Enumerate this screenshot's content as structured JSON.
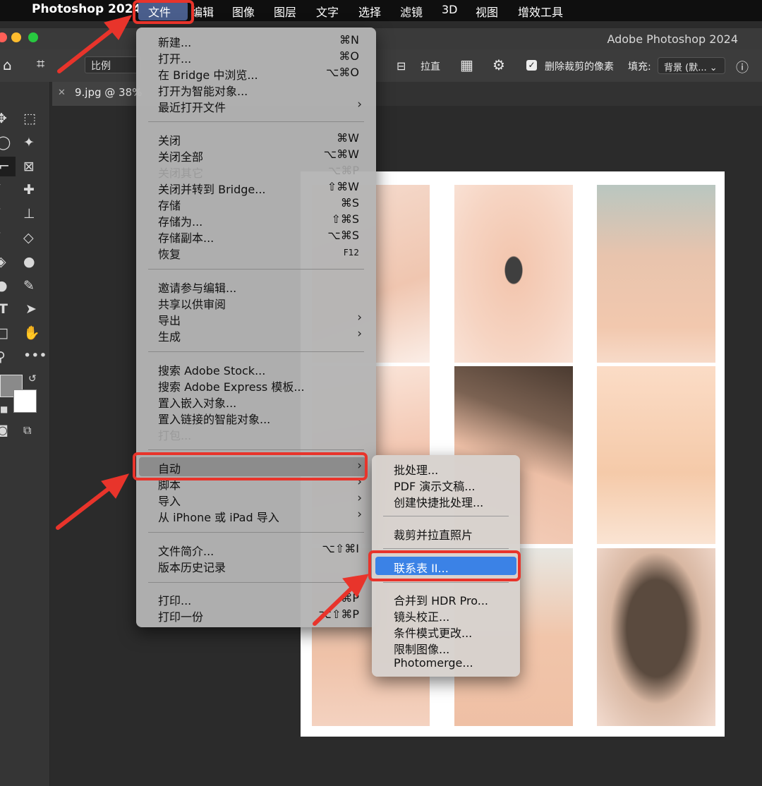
{
  "menubar": {
    "apple_icon": "apple-icon",
    "app_name": "Photoshop 2024",
    "items": [
      "文件",
      "编辑",
      "图像",
      "图层",
      "文字",
      "选择",
      "滤镜",
      "3D",
      "视图",
      "增效工具"
    ]
  },
  "window": {
    "title": "Adobe Photoshop 2024"
  },
  "options_bar": {
    "ratio": "比例",
    "straighten": "拉直",
    "delete_cropped": "删除裁剪的像素",
    "delete_cropped_checked": true,
    "fill_label": "填充:",
    "fill_value": "背景 (默...",
    "icons": [
      "home-icon",
      "crop-icon",
      "straighten-icon",
      "grid-overlay-icon",
      "gear-icon",
      "info-icon"
    ]
  },
  "tab": {
    "name": "9.jpg @ 38%"
  },
  "file_menu": {
    "items": [
      {
        "label": "新建...",
        "shortcut": "⌘N"
      },
      {
        "label": "打开...",
        "shortcut": "⌘O"
      },
      {
        "label": "在 Bridge 中浏览...",
        "shortcut": "⌥⌘O"
      },
      {
        "label": "打开为智能对象..."
      },
      {
        "label": "最近打开文件",
        "submenu": true
      },
      {
        "label": "关闭",
        "shortcut": "⌘W"
      },
      {
        "label": "关闭全部",
        "shortcut": "⌥⌘W"
      },
      {
        "label": "关闭其它",
        "shortcut": "⌥⌘P",
        "disabled": true
      },
      {
        "label": "关闭并转到 Bridge...",
        "shortcut": "⇧⌘W"
      },
      {
        "label": "存储",
        "shortcut": "⌘S"
      },
      {
        "label": "存储为...",
        "shortcut": "⇧⌘S"
      },
      {
        "label": "存储副本...",
        "shortcut": "⌥⌘S"
      },
      {
        "label": "恢复",
        "shortcut": "F12"
      },
      {
        "label": "邀请参与编辑..."
      },
      {
        "label": "共享以供审阅"
      },
      {
        "label": "导出",
        "submenu": true
      },
      {
        "label": "生成",
        "submenu": true
      },
      {
        "label": "搜索 Adobe Stock..."
      },
      {
        "label": "搜索 Adobe Express 模板..."
      },
      {
        "label": "置入嵌入对象..."
      },
      {
        "label": "置入链接的智能对象..."
      },
      {
        "label": "打包...",
        "disabled": true
      },
      {
        "label": "自动",
        "submenu": true,
        "highlighted": true
      },
      {
        "label": "脚本",
        "submenu": true
      },
      {
        "label": "导入",
        "submenu": true
      },
      {
        "label": "从 iPhone 或 iPad 导入",
        "submenu": true
      },
      {
        "label": "文件简介...",
        "shortcut": "⌥⇧⌘I"
      },
      {
        "label": "版本历史记录"
      },
      {
        "label": "打印...",
        "shortcut": "⌘P"
      },
      {
        "label": "打印一份",
        "shortcut": "⌥⇧⌘P"
      }
    ]
  },
  "automate_submenu": {
    "items": [
      {
        "label": "批处理..."
      },
      {
        "label": "PDF 演示文稿..."
      },
      {
        "label": "创建快捷批处理..."
      },
      {
        "label": "裁剪并拉直照片"
      },
      {
        "label": "联系表 II...",
        "highlighted": true
      },
      {
        "label": "合并到 HDR Pro..."
      },
      {
        "label": "镜头校正..."
      },
      {
        "label": "条件模式更改..."
      },
      {
        "label": "限制图像..."
      },
      {
        "label": "Photomerge..."
      }
    ]
  },
  "toolbar": {
    "tools": [
      "move-icon",
      "marquee-icon",
      "lasso-icon",
      "magic-wand-icon",
      "crop-icon",
      "frame-icon",
      "eyedropper-icon",
      "healing-brush-icon",
      "brush-icon",
      "clone-stamp-icon",
      "history-brush-icon",
      "eraser-icon",
      "paint-bucket-icon",
      "blur-icon",
      "dodge-icon",
      "pen-icon",
      "type-icon",
      "path-selection-icon",
      "rectangle-icon",
      "hand-icon",
      "zoom-icon",
      "more-tools-icon",
      "swap-colors-icon",
      "default-colors-icon",
      "quick-mask-icon",
      "screen-mode-icon"
    ]
  },
  "colors": {
    "accent_highlight": "#3b82e6",
    "annotation_red": "#e8342b"
  }
}
